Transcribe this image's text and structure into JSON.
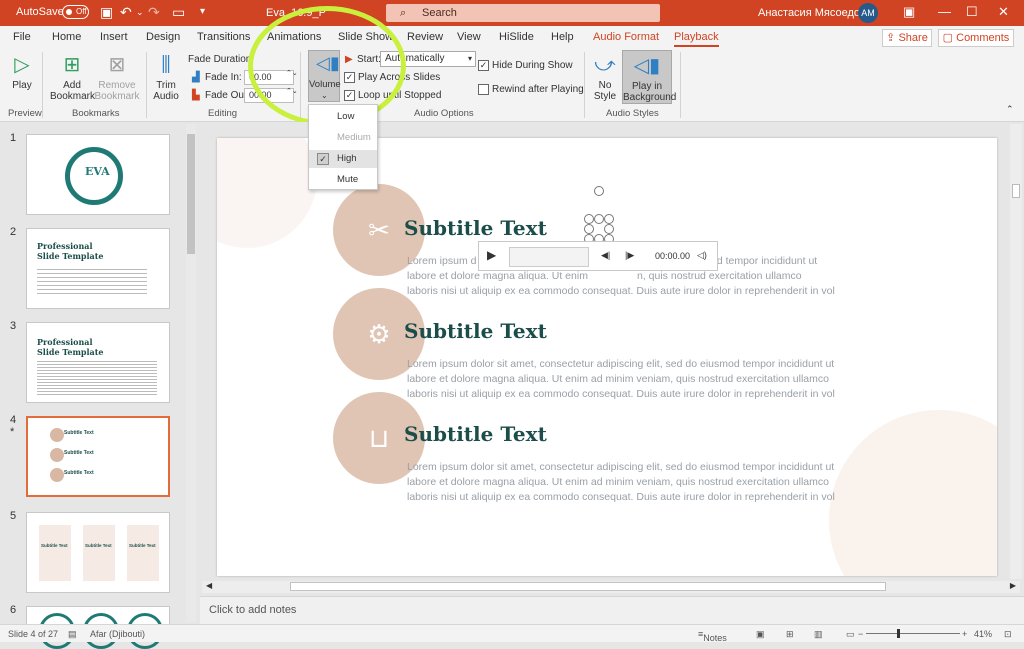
{
  "titlebar": {
    "autosave_label": "AutoSave",
    "autosave_state": "Off",
    "doc_title": "Eva_16:9_P",
    "search_placeholder": "Search",
    "user_name": "Анастасия Мясоедова",
    "avatar_initials": "AM"
  },
  "tabs": [
    "File",
    "Home",
    "Insert",
    "Design",
    "Transitions",
    "Animations",
    "Slide Show",
    "Review",
    "View",
    "HiSlide",
    "Help",
    "Audio Format",
    "Playback"
  ],
  "tab_actions": {
    "share": "Share",
    "comments": "Comments"
  },
  "ribbon": {
    "play": "Play",
    "add_bookmark": [
      "Add",
      "Bookmark"
    ],
    "remove_bookmark": [
      "Remove",
      "Bookmark"
    ],
    "trim": [
      "Trim",
      "Audio"
    ],
    "fade_duration": "Fade Duration",
    "fade_in_label": "Fade In:",
    "fade_in_value": "00.00",
    "fade_out_label": "Fade Out:",
    "fade_out_value": "00.00",
    "volume": "Volume",
    "start_label": "Start:",
    "start_value": "Automatically",
    "play_across": "Play Across Slides",
    "loop": "Loop until Stopped",
    "hide": "Hide During Show",
    "rewind": "Rewind after Playing",
    "no_style": [
      "No",
      "Style"
    ],
    "play_bg": [
      "Play in",
      "Background"
    ],
    "groups": {
      "preview": "Preview",
      "bookmarks": "Bookmarks",
      "editing": "Editing",
      "audio_options": "Audio Options",
      "audio_styles": "Audio Styles"
    }
  },
  "volume_menu": {
    "items": [
      "Low",
      "Medium",
      "High",
      "Mute"
    ],
    "selected": "High"
  },
  "slides": [
    {
      "num": "1",
      "title": "EVA"
    },
    {
      "num": "2",
      "title": "Professional Slide Template"
    },
    {
      "num": "3",
      "title": "Professional Slide Template"
    },
    {
      "num": "4",
      "marker": "*",
      "title": "Subtitle Text"
    },
    {
      "num": "5",
      "title": "Subtitle Text"
    },
    {
      "num": "6",
      "title": ""
    }
  ],
  "slide_content": {
    "items": [
      {
        "title": "Subtitle Text",
        "icon": "scissors-icon",
        "lines": [
          "Lorem ipsum d",
          "labore et dolore magna aliqua. Ut enim",
          "laboris nisi ut aliquip ex ea commodo consequat. Duis aute irure dolor in reprehenderit in vol"
        ]
      },
      {
        "title": "Subtitle Text",
        "icon": "gear-icon",
        "lines": [
          "Lorem ipsum dolor sit amet, consectetur adipiscing elit, sed do eiusmod tempor incididunt ut",
          "labore et dolore magna aliqua. Ut enim ad minim veniam, quis nostrud exercitation ullamco",
          "laboris nisi ut aliquip ex ea commodo consequat. Duis aute irure dolor in reprehenderit in vol"
        ]
      },
      {
        "title": "Subtitle Text",
        "icon": "basket-icon",
        "lines": [
          "Lorem ipsum dolor sit amet, consectetur adipiscing elit, sed do eiusmod tempor incididunt ut",
          "labore et dolore magna aliqua. Ut enim ad minim veniam, quis nostrud exercitation ullamco",
          "laboris nisi ut aliquip ex ea commodo consequat. Duis aute irure dolor in reprehenderit in vol"
        ]
      }
    ],
    "first_line_right": "smod tempor incididunt ut",
    "second_line_right": "n, quis nostrud exercitation ullamco"
  },
  "player": {
    "time": "00:00.00"
  },
  "notes_placeholder": "Click to add notes",
  "status": {
    "slide": "Slide 4 of 27",
    "language": "Afar (Djibouti)",
    "notes": "Notes",
    "zoom": "41%"
  }
}
